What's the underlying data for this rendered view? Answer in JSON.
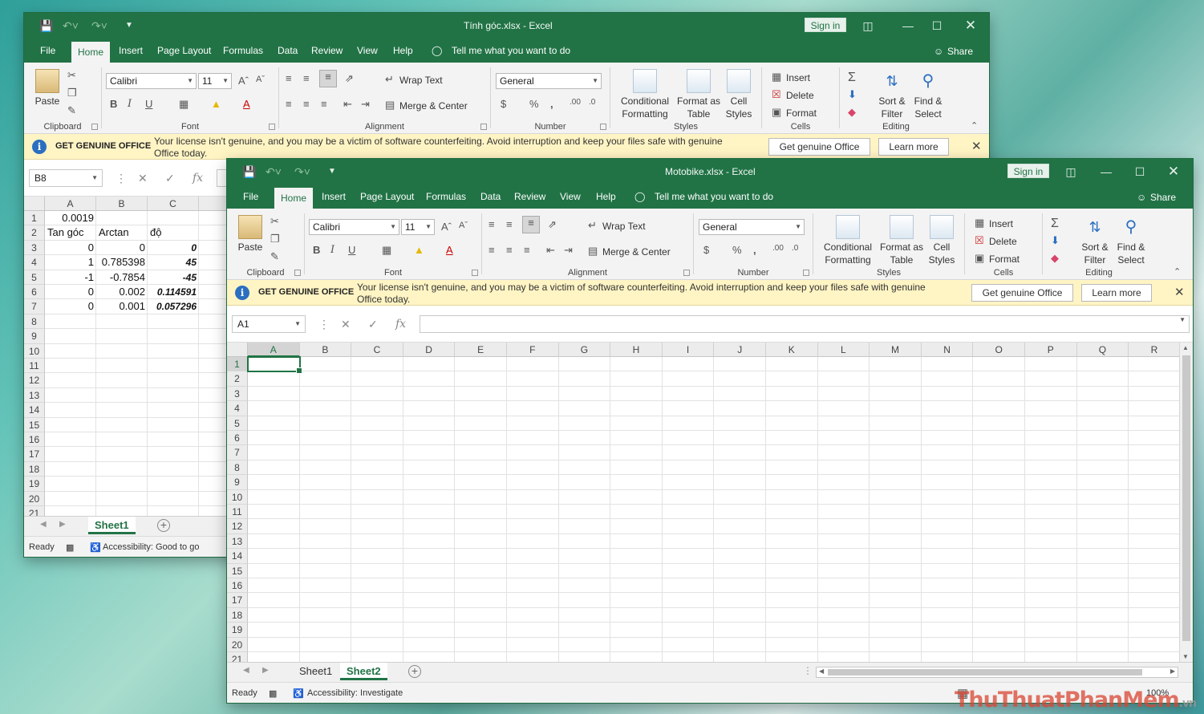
{
  "colors": {
    "excel_green": "#217346",
    "banner": "#fff4c4"
  },
  "w1": {
    "title": "Tính góc.xlsx  -  Excel",
    "signin": "Sign in",
    "share": "Share",
    "tabs": [
      "File",
      "Home",
      "Insert",
      "Page Layout",
      "Formulas",
      "Data",
      "Review",
      "View",
      "Help"
    ],
    "tell": "Tell me what you want to do",
    "ribbon": {
      "paste": "Paste",
      "font": "Calibri",
      "size": "11",
      "wrap": "Wrap Text",
      "merge": "Merge & Center",
      "numfmt": "General",
      "cond1": "Conditional",
      "cond2": "Formatting",
      "fmtas1": "Format as",
      "fmtas2": "Table",
      "cell1": "Cell",
      "cell2": "Styles",
      "insert": "Insert",
      "delete": "Delete",
      "format": "Format",
      "sort1": "Sort &",
      "sort2": "Filter",
      "find1": "Find &",
      "find2": "Select",
      "groups": {
        "clipboard": "Clipboard",
        "font": "Font",
        "alignment": "Alignment",
        "number": "Number",
        "styles": "Styles",
        "cells": "Cells",
        "editing": "Editing"
      }
    },
    "banner": {
      "title": "GET GENUINE OFFICE",
      "msg": "Your license isn't genuine, and you may be a victim of software counterfeiting. Avoid interruption and keep your files safe with genuine Office today.",
      "btn1": "Get genuine Office",
      "btn2": "Learn more"
    },
    "namebox": "B8",
    "cols": [
      "A",
      "B",
      "C"
    ],
    "rows": [
      "1",
      "2",
      "3",
      "4",
      "5",
      "6",
      "7",
      "8",
      "9",
      "10",
      "11",
      "12",
      "13",
      "14",
      "15",
      "16",
      "17",
      "18",
      "19",
      "20",
      "21"
    ],
    "cells": {
      "a1": "0.0019",
      "a2": "Tan góc",
      "b2": "Arctan",
      "c2": "độ",
      "a3": "0",
      "b3": "0",
      "c3": "0",
      "a4": "1",
      "b4": "0.785398",
      "c4": "45",
      "a5": "-1",
      "b5": "-0.7854",
      "c5": "-45",
      "a6": "0",
      "b6": "0.002",
      "c6": "0.114591",
      "a7": "0",
      "b7": "0.001",
      "c7": "0.057296"
    },
    "sheets": [
      "Sheet1"
    ],
    "status": {
      "ready": "Ready",
      "access": "Accessibility: Good to go"
    }
  },
  "w2": {
    "title": "Motobike.xlsx  -  Excel",
    "signin": "Sign in",
    "share": "Share",
    "tabs": [
      "File",
      "Home",
      "Insert",
      "Page Layout",
      "Formulas",
      "Data",
      "Review",
      "View",
      "Help"
    ],
    "tell": "Tell me what you want to do",
    "ribbon": {
      "paste": "Paste",
      "font": "Calibri",
      "size": "11",
      "wrap": "Wrap Text",
      "merge": "Merge & Center",
      "numfmt": "General",
      "cond1": "Conditional",
      "cond2": "Formatting",
      "fmtas1": "Format as",
      "fmtas2": "Table",
      "cell1": "Cell",
      "cell2": "Styles",
      "insert": "Insert",
      "delete": "Delete",
      "format": "Format",
      "sort1": "Sort &",
      "sort2": "Filter",
      "find1": "Find &",
      "find2": "Select",
      "groups": {
        "clipboard": "Clipboard",
        "font": "Font",
        "alignment": "Alignment",
        "number": "Number",
        "styles": "Styles",
        "cells": "Cells",
        "editing": "Editing"
      }
    },
    "banner": {
      "title": "GET GENUINE OFFICE",
      "msg": "Your license isn't genuine, and you may be a victim of software counterfeiting. Avoid interruption and keep your files safe with genuine Office today.",
      "btn1": "Get genuine Office",
      "btn2": "Learn more"
    },
    "namebox": "A1",
    "cols": [
      "A",
      "B",
      "C",
      "D",
      "E",
      "F",
      "G",
      "H",
      "I",
      "J",
      "K",
      "L",
      "M",
      "N",
      "O",
      "P",
      "Q",
      "R"
    ],
    "rows": [
      "1",
      "2",
      "3",
      "4",
      "5",
      "6",
      "7",
      "8",
      "9",
      "10",
      "11",
      "12",
      "13",
      "14",
      "15",
      "16",
      "17",
      "18",
      "19",
      "20",
      "21"
    ],
    "sheets": [
      "Sheet1",
      "Sheet2"
    ],
    "status": {
      "ready": "Ready",
      "access": "Accessibility: Investigate",
      "zoom": "100%"
    }
  },
  "watermark": {
    "a": "ThuThuat",
    "b": "PhanMem",
    "c": ".vn"
  }
}
